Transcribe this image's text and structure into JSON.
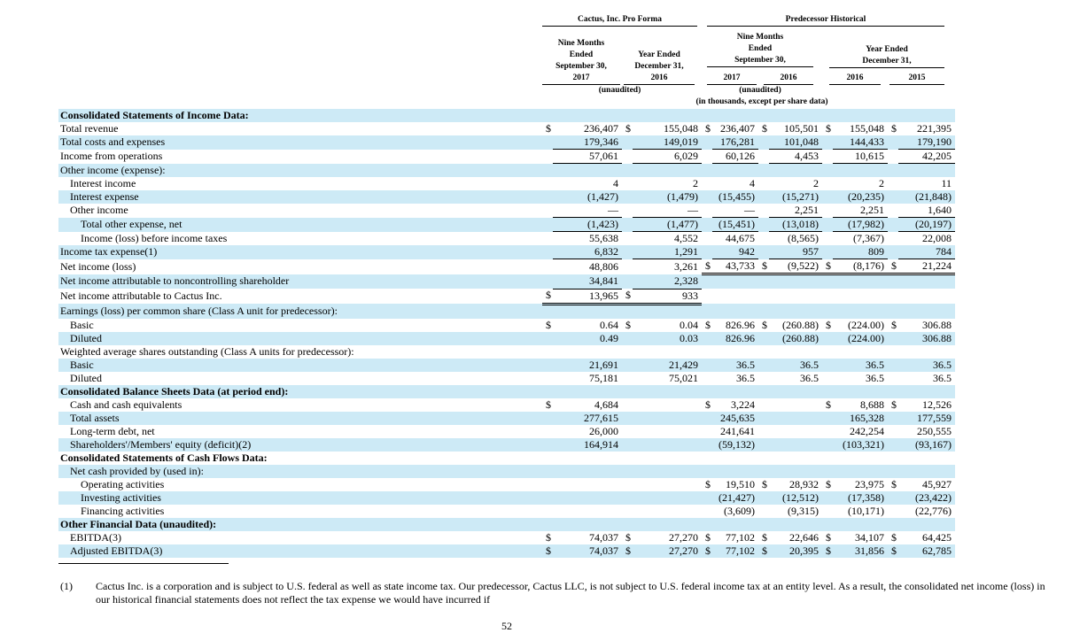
{
  "header": {
    "group_proforma": "Cactus, Inc. Pro Forma",
    "group_predecessor": "Predecessor Historical",
    "col1_period": "Nine Months\nEnded\nSeptember 30,",
    "col1_year": "2017",
    "col2_period": "Year Ended\nDecember 31,",
    "col2_year": "2016",
    "nine_months": "Nine Months\nEnded\nSeptember 30,",
    "nine_2017": "2017",
    "nine_2016": "2016",
    "year_ended": "Year Ended\nDecember 31,",
    "year_2016": "2016",
    "year_2015": "2015",
    "unaudited_left": "(unaudited)",
    "unaudited_right": "(unaudited)",
    "units": "(in thousands, except per share data)"
  },
  "rows": [
    {
      "label": "Consolidated Statements of Income Data:",
      "indent": 0,
      "bold": true,
      "shade": true,
      "cells": []
    },
    {
      "label": "Total revenue",
      "indent": 0,
      "shade": false,
      "cells": [
        {
          "d": "$",
          "v": "236,407"
        },
        {
          "d": "$",
          "v": "155,048"
        },
        {
          "d": "$",
          "v": "236,407"
        },
        {
          "d": "$",
          "v": "105,501"
        },
        {
          "d": "$",
          "v": "155,048"
        },
        {
          "d": "$",
          "v": "221,395"
        }
      ]
    },
    {
      "label": "Total costs and expenses",
      "indent": 0,
      "shade": true,
      "cells": [
        {
          "v": "179,346",
          "u": 1
        },
        {
          "v": "149,019",
          "u": 1
        },
        {
          "v": "176,281",
          "u": 1
        },
        {
          "v": "101,048",
          "u": 1
        },
        {
          "v": "144,433",
          "u": 1
        },
        {
          "v": "179,190",
          "u": 1
        }
      ]
    },
    {
      "label": "Income from operations",
      "indent": 0,
      "shade": false,
      "cells": [
        {
          "v": "57,061",
          "u": 1
        },
        {
          "v": "6,029",
          "u": 1
        },
        {
          "v": "60,126",
          "u": 1
        },
        {
          "v": "4,453",
          "u": 1
        },
        {
          "v": "10,615",
          "u": 1
        },
        {
          "v": "42,205",
          "u": 1
        }
      ]
    },
    {
      "label": "Other income (expense):",
      "indent": 0,
      "shade": true,
      "cells": []
    },
    {
      "label": "Interest income",
      "indent": 1,
      "shade": false,
      "cells": [
        {
          "v": "4"
        },
        {
          "v": "2"
        },
        {
          "v": "4"
        },
        {
          "v": "2"
        },
        {
          "v": "2"
        },
        {
          "v": "11"
        }
      ]
    },
    {
      "label": "Interest expense",
      "indent": 1,
      "shade": true,
      "cells": [
        {
          "v": "(1,427)"
        },
        {
          "v": "(1,479)"
        },
        {
          "v": "(15,455)"
        },
        {
          "v": "(15,271)"
        },
        {
          "v": "(20,235)"
        },
        {
          "v": "(21,848)"
        }
      ]
    },
    {
      "label": "Other income",
      "indent": 1,
      "shade": false,
      "cells": [
        {
          "v": "—",
          "u": 1
        },
        {
          "v": "—",
          "u": 1
        },
        {
          "v": "—",
          "u": 1
        },
        {
          "v": "2,251",
          "u": 1
        },
        {
          "v": "2,251",
          "u": 1
        },
        {
          "v": "1,640",
          "u": 1
        }
      ]
    },
    {
      "label": "Total other expense, net",
      "indent": 2,
      "shade": true,
      "cells": [
        {
          "v": "(1,423)",
          "u": 1
        },
        {
          "v": "(1,477)",
          "u": 1
        },
        {
          "v": "(15,451)",
          "u": 1
        },
        {
          "v": "(13,018)",
          "u": 1
        },
        {
          "v": "(17,982)",
          "u": 1
        },
        {
          "v": "(20,197)",
          "u": 1
        }
      ]
    },
    {
      "label": "Income (loss) before income taxes",
      "indent": 2,
      "shade": false,
      "cells": [
        {
          "v": "55,638"
        },
        {
          "v": "4,552"
        },
        {
          "v": "44,675"
        },
        {
          "v": "(8,565)"
        },
        {
          "v": "(7,367)"
        },
        {
          "v": "22,008"
        }
      ]
    },
    {
      "label": "Income tax expense(1)",
      "indent": 0,
      "shade": true,
      "cells": [
        {
          "v": "6,832",
          "u": 1
        },
        {
          "v": "1,291",
          "u": 1
        },
        {
          "v": "942",
          "u": 1
        },
        {
          "v": "957",
          "u": 1
        },
        {
          "v": "809",
          "u": 1
        },
        {
          "v": "784",
          "u": 1
        }
      ]
    },
    {
      "label": "Net income (loss)",
      "indent": 0,
      "shade": false,
      "cells": [
        {
          "v": "48,806"
        },
        {
          "v": "3,261"
        },
        {
          "d": "$",
          "v": "43,733",
          "u": 2
        },
        {
          "d": "$",
          "v": "(9,522)",
          "u": 2
        },
        {
          "d": "$",
          "v": "(8,176)",
          "u": 2
        },
        {
          "d": "$",
          "v": "21,224",
          "u": 2
        }
      ]
    },
    {
      "label": "Net income attributable to noncontrolling shareholder",
      "indent": 0,
      "shade": true,
      "cells": [
        {
          "v": "34,841",
          "u": 1
        },
        {
          "v": "2,328",
          "u": 1
        },
        {},
        {},
        {},
        {}
      ]
    },
    {
      "label": "Net income attributable to Cactus Inc.",
      "indent": 0,
      "shade": false,
      "cells": [
        {
          "d": "$",
          "v": "13,965",
          "u": 2
        },
        {
          "d": "$",
          "v": "933",
          "u": 2
        },
        {},
        {},
        {},
        {}
      ]
    },
    {
      "label": "Earnings (loss) per common share (Class A unit for predecessor):",
      "indent": 0,
      "shade": true,
      "cells": []
    },
    {
      "label": "Basic",
      "indent": 1,
      "shade": false,
      "cells": [
        {
          "d": "$",
          "v": "0.64"
        },
        {
          "d": "$",
          "v": "0.04"
        },
        {
          "d": "$",
          "v": "826.96"
        },
        {
          "d": "$",
          "v": "(260.88)"
        },
        {
          "d": "$",
          "v": "(224.00)"
        },
        {
          "d": "$",
          "v": "306.88"
        }
      ]
    },
    {
      "label": "Diluted",
      "indent": 1,
      "shade": true,
      "cells": [
        {
          "v": "0.49"
        },
        {
          "v": "0.03"
        },
        {
          "v": "826.96"
        },
        {
          "v": "(260.88)"
        },
        {
          "v": "(224.00)"
        },
        {
          "v": "306.88"
        }
      ]
    },
    {
      "label": "Weighted average shares outstanding (Class A units for predecessor):",
      "indent": 0,
      "shade": false,
      "cells": []
    },
    {
      "label": "Basic",
      "indent": 1,
      "shade": true,
      "cells": [
        {
          "v": "21,691"
        },
        {
          "v": "21,429"
        },
        {
          "v": "36.5"
        },
        {
          "v": "36.5"
        },
        {
          "v": "36.5"
        },
        {
          "v": "36.5"
        }
      ]
    },
    {
      "label": "Diluted",
      "indent": 1,
      "shade": false,
      "cells": [
        {
          "v": "75,181"
        },
        {
          "v": "75,021"
        },
        {
          "v": "36.5"
        },
        {
          "v": "36.5"
        },
        {
          "v": "36.5"
        },
        {
          "v": "36.5"
        }
      ]
    },
    {
      "label": "Consolidated Balance Sheets Data (at period end):",
      "indent": 0,
      "bold": true,
      "shade": true,
      "cells": []
    },
    {
      "label": "Cash and cash equivalents",
      "indent": 1,
      "shade": false,
      "cells": [
        {
          "d": "$",
          "v": "4,684"
        },
        {},
        {
          "d": "$",
          "v": "3,224"
        },
        {},
        {
          "d": "$",
          "v": "8,688"
        },
        {
          "d": "$",
          "v": "12,526"
        }
      ]
    },
    {
      "label": "Total assets",
      "indent": 1,
      "shade": true,
      "cells": [
        {
          "v": "277,615"
        },
        {},
        {
          "v": "245,635"
        },
        {},
        {
          "v": "165,328"
        },
        {
          "v": "177,559"
        }
      ]
    },
    {
      "label": "Long-term debt, net",
      "indent": 1,
      "shade": false,
      "cells": [
        {
          "v": "26,000"
        },
        {},
        {
          "v": "241,641"
        },
        {},
        {
          "v": "242,254"
        },
        {
          "v": "250,555"
        }
      ]
    },
    {
      "label": "Shareholders'/Members' equity (deficit)(2)",
      "indent": 1,
      "shade": true,
      "cells": [
        {
          "v": "164,914"
        },
        {},
        {
          "v": "(59,132)"
        },
        {},
        {
          "v": "(103,321)"
        },
        {
          "v": "(93,167)"
        }
      ]
    },
    {
      "label": "Consolidated Statements of Cash Flows Data:",
      "indent": 0,
      "bold": true,
      "shade": false,
      "cells": []
    },
    {
      "label": "Net cash provided by (used in):",
      "indent": 1,
      "shade": true,
      "cells": []
    },
    {
      "label": "Operating activities",
      "indent": 2,
      "shade": false,
      "cells": [
        {},
        {},
        {
          "d": "$",
          "v": "19,510"
        },
        {
          "d": "$",
          "v": "28,932"
        },
        {
          "d": "$",
          "v": "23,975"
        },
        {
          "d": "$",
          "v": "45,927"
        }
      ]
    },
    {
      "label": "Investing activities",
      "indent": 2,
      "shade": true,
      "cells": [
        {},
        {},
        {
          "v": "(21,427)"
        },
        {
          "v": "(12,512)"
        },
        {
          "v": "(17,358)"
        },
        {
          "v": "(23,422)"
        }
      ]
    },
    {
      "label": "Financing activities",
      "indent": 2,
      "shade": false,
      "cells": [
        {},
        {},
        {
          "v": "(3,609)"
        },
        {
          "v": "(9,315)"
        },
        {
          "v": "(10,171)"
        },
        {
          "v": "(22,776)"
        }
      ]
    },
    {
      "label": "Other Financial Data (unaudited):",
      "indent": 0,
      "bold": true,
      "shade": true,
      "cells": []
    },
    {
      "label": "EBITDA(3)",
      "indent": 1,
      "shade": false,
      "cells": [
        {
          "d": "$",
          "v": "74,037"
        },
        {
          "d": "$",
          "v": "27,270"
        },
        {
          "d": "$",
          "v": "77,102"
        },
        {
          "d": "$",
          "v": "22,646"
        },
        {
          "d": "$",
          "v": "34,107"
        },
        {
          "d": "$",
          "v": "64,425"
        }
      ]
    },
    {
      "label": "Adjusted EBITDA(3)",
      "indent": 1,
      "shade": true,
      "cells": [
        {
          "d": "$",
          "v": "74,037"
        },
        {
          "d": "$",
          "v": "27,270"
        },
        {
          "d": "$",
          "v": "77,102"
        },
        {
          "d": "$",
          "v": "20,395"
        },
        {
          "d": "$",
          "v": "31,856"
        },
        {
          "d": "$",
          "v": "62,785"
        }
      ]
    }
  ],
  "footnote": {
    "marker": "(1)",
    "text": "Cactus Inc. is a corporation and is subject to U.S. federal as well as state income tax. Our predecessor, Cactus LLC, is not subject to U.S. federal income tax at an entity level. As a result, the consolidated net income (loss) in our historical financial statements does not reflect the tax expense we would have incurred if"
  },
  "page_number": "52"
}
